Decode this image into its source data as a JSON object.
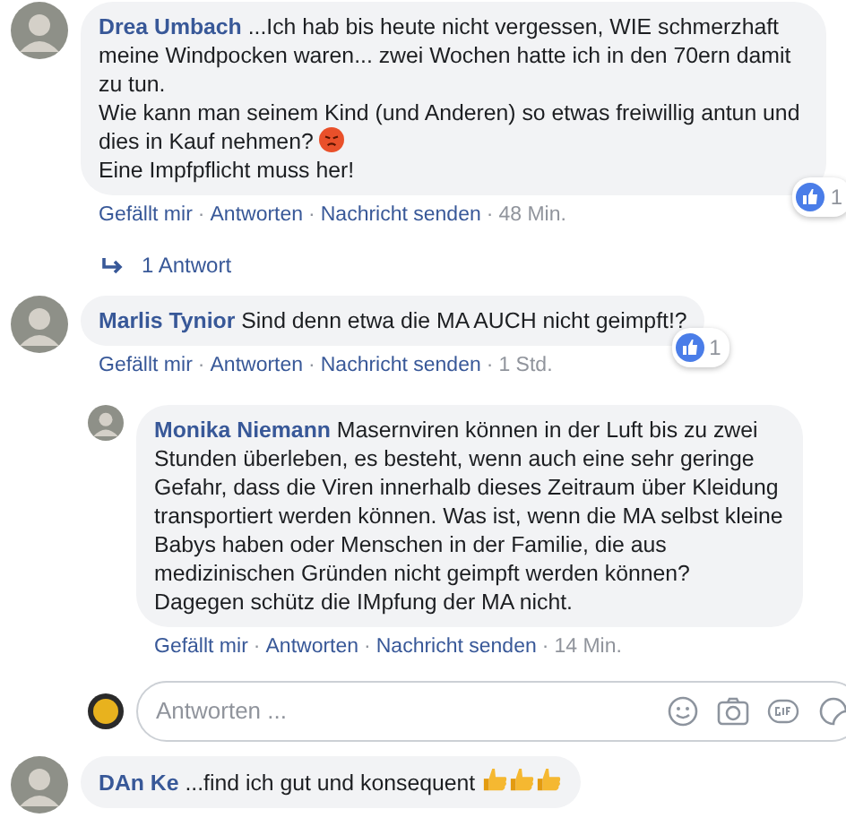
{
  "comments": [
    {
      "author": "Drea Umbach",
      "body": [
        {
          "kind": "text",
          "text": "...Ich hab bis heute nicht vergessen, WIE schmerzhaft meine Windpocken waren... zwei Wochen hatte ich in den 70ern damit zu tun.\nWie kann man seinem Kind (und Anderen) so etwas freiwillig antun und dies in Kauf nehmen? "
        },
        {
          "kind": "angry"
        },
        {
          "kind": "text",
          "text": "\nEine Impfpflicht muss her!"
        }
      ],
      "reaction_count": "1",
      "meta": [
        {
          "kind": "link",
          "text": "Gefällt mir"
        },
        {
          "kind": "sep",
          "text": "·"
        },
        {
          "kind": "link",
          "text": "Antworten"
        },
        {
          "kind": "sep",
          "text": "·"
        },
        {
          "kind": "link",
          "text": "Nachricht senden"
        },
        {
          "kind": "sep",
          "text": "·"
        },
        {
          "kind": "time",
          "text": "48 Min."
        }
      ],
      "replies_link": "1 Antwort"
    },
    {
      "author": "Marlis Tynior",
      "body": [
        {
          "kind": "text",
          "text": "Sind denn etwa die MA AUCH nicht geimpft!?"
        }
      ],
      "reaction_count": "1",
      "meta": [
        {
          "kind": "link",
          "text": "Gefällt mir"
        },
        {
          "kind": "sep",
          "text": "·"
        },
        {
          "kind": "link",
          "text": "Antworten"
        },
        {
          "kind": "sep",
          "text": "·"
        },
        {
          "kind": "link",
          "text": "Nachricht senden"
        },
        {
          "kind": "sep",
          "text": "·"
        },
        {
          "kind": "time",
          "text": "1 Std."
        }
      ],
      "replies": [
        {
          "author": "Monika Niemann",
          "body": [
            {
              "kind": "text",
              "text": "Masernviren können in der Luft bis zu zwei Stunden überleben, es besteht, wenn auch eine sehr geringe Gefahr, dass die Viren innerhalb dieses Zeitraum über Kleidung transportiert werden können. Was ist, wenn die MA selbst kleine Babys haben oder Menschen in der Familie, die aus medizinischen Gründen nicht geimpft werden können? Dagegen schütz die IMpfung der MA nicht."
            }
          ],
          "meta": [
            {
              "kind": "link",
              "text": "Gefällt mir"
            },
            {
              "kind": "sep",
              "text": "·"
            },
            {
              "kind": "link",
              "text": "Antworten"
            },
            {
              "kind": "sep",
              "text": "·"
            },
            {
              "kind": "link",
              "text": "Nachricht senden"
            },
            {
              "kind": "sep",
              "text": "·"
            },
            {
              "kind": "time",
              "text": "14 Min."
            }
          ]
        }
      ],
      "reply_box": {
        "placeholder": "Antworten ..."
      }
    },
    {
      "author": "DAn Ke",
      "body": [
        {
          "kind": "text",
          "text": "...find ich gut und konsequent "
        },
        {
          "kind": "thumbs"
        },
        {
          "kind": "thumbs"
        },
        {
          "kind": "thumbs"
        }
      ]
    }
  ]
}
